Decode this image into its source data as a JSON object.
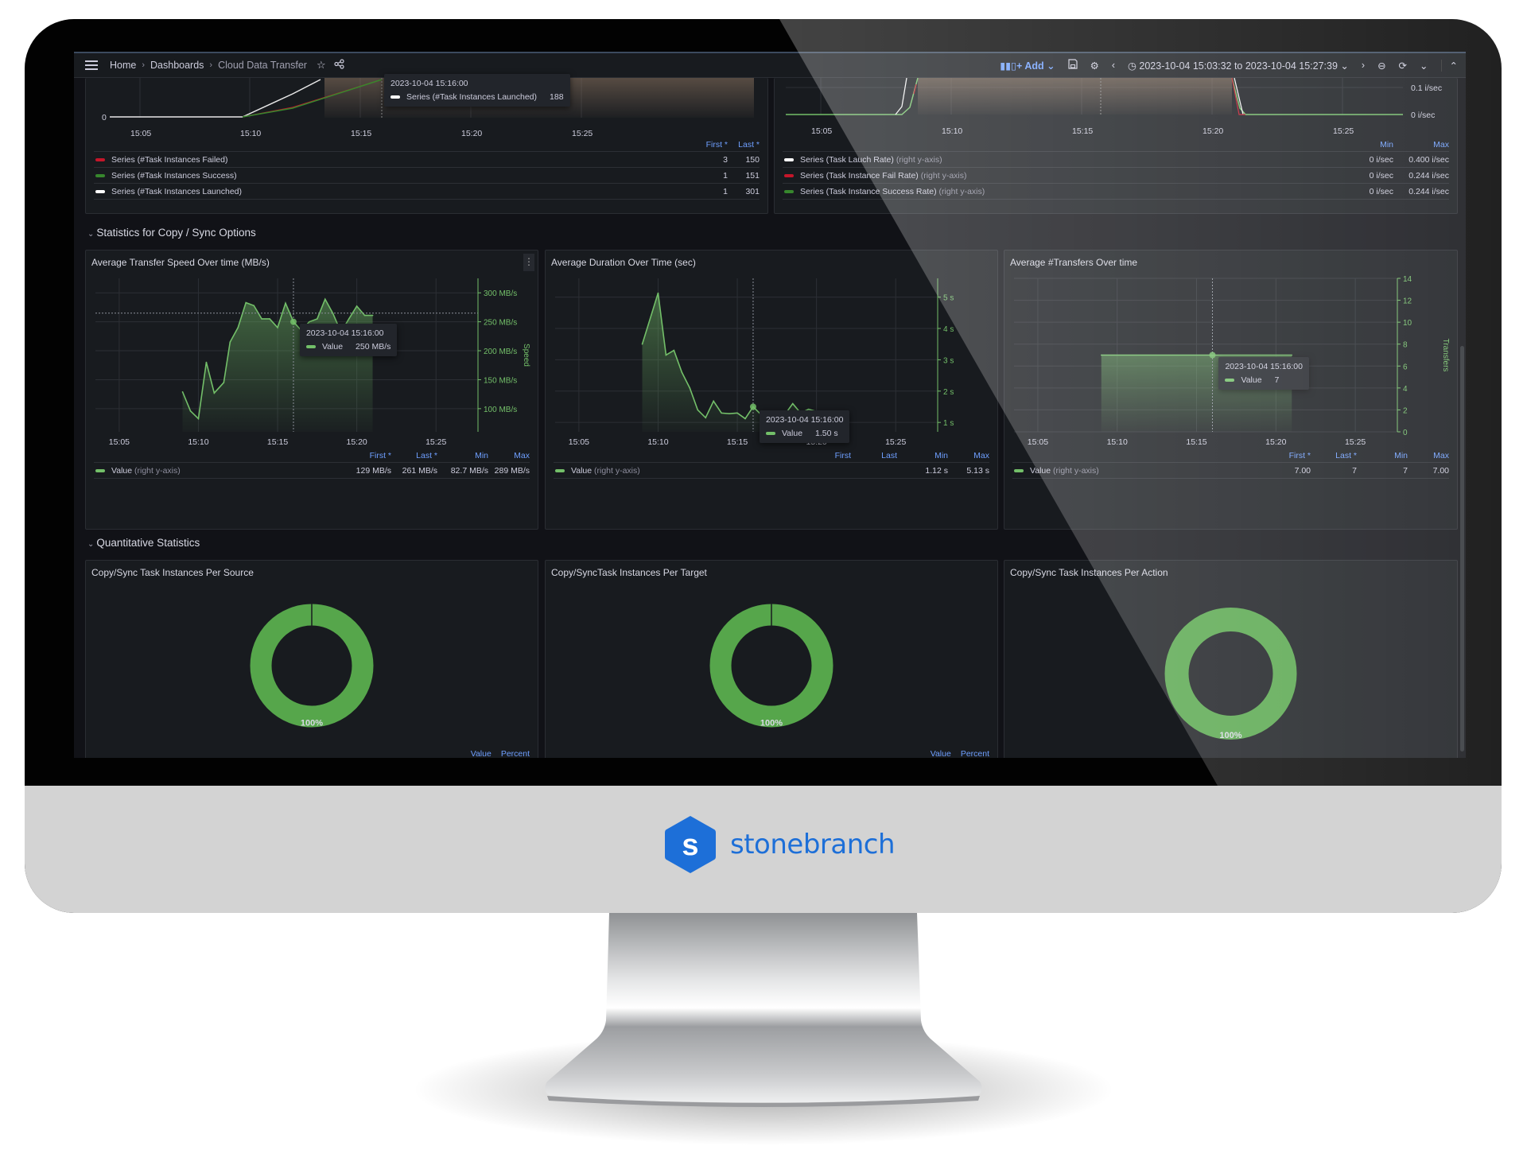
{
  "nav": {
    "breadcrumb": [
      "Home",
      "Dashboards",
      "Cloud Data Transfer"
    ],
    "add_label": "Add",
    "time_range": "2023-10-04 15:03:32 to 2023-10-04 15:27:39",
    "icons": [
      "menu-icon",
      "star-icon",
      "share-icon",
      "add-panel-icon",
      "save-icon",
      "settings-icon",
      "chevron-left-icon",
      "clock-icon",
      "chevron-down-icon",
      "chevron-right-icon",
      "zoom-out-icon",
      "refresh-icon",
      "chevron-down-icon",
      "chevron-up-icon"
    ]
  },
  "top_left_panel": {
    "tooltip": {
      "time": "2023-10-04 15:16:00",
      "series": "Series (#Task Instances Launched)",
      "value": "188"
    },
    "y_zero": "0",
    "x_ticks": [
      "15:05",
      "15:10",
      "15:15",
      "15:20",
      "15:25"
    ],
    "legend_headers": [
      "First *",
      "Last *"
    ],
    "legend": [
      {
        "name": "Series (#Task Instances Failed)",
        "first": "3",
        "last": "150",
        "color": "#c4162a"
      },
      {
        "name": "Series (#Task Instances Success)",
        "first": "1",
        "last": "151",
        "color": "#37872d"
      },
      {
        "name": "Series (#Task Instances Launched)",
        "first": "1",
        "last": "301",
        "color": "#ffffff"
      }
    ]
  },
  "top_right_panel": {
    "y_ticks": [
      "0.1 i/sec",
      "0 i/sec"
    ],
    "x_ticks": [
      "15:05",
      "15:10",
      "15:15",
      "15:20",
      "15:25"
    ],
    "legend_headers": [
      "Min",
      "Max"
    ],
    "legend": [
      {
        "name": "Series (Task Lauch Rate)",
        "axis": "(right y-axis)",
        "min": "0 i/sec",
        "max": "0.400 i/sec",
        "color": "#ffffff"
      },
      {
        "name": "Series (Task Instance Fail Rate)",
        "axis": "(right y-axis)",
        "min": "0 i/sec",
        "max": "0.244 i/sec",
        "color": "#c4162a"
      },
      {
        "name": "Series (Task Instance Success Rate)",
        "axis": "(right y-axis)",
        "min": "0 i/sec",
        "max": "0.244 i/sec",
        "color": "#37872d"
      }
    ]
  },
  "sections": {
    "copy_sync": "Statistics for Copy / Sync Options",
    "quantitative": "Quantitative Statistics"
  },
  "chart_data": [
    {
      "type": "area",
      "title": "Average Transfer Speed Over time (MB/s)",
      "ylabel": "Speed",
      "x_ticks": [
        "15:05",
        "15:10",
        "15:15",
        "15:20",
        "15:25"
      ],
      "y_ticks": [
        "100 MB/s",
        "150 MB/s",
        "200 MB/s",
        "250 MB/s",
        "300 MB/s"
      ],
      "xlim_minutes": [
        3.5,
        27.65
      ],
      "ylim": [
        60,
        325
      ],
      "x_minutes": [
        9.0,
        9.5,
        10.0,
        10.5,
        11.0,
        11.6,
        12.0,
        12.5,
        13.0,
        13.5,
        14.0,
        14.5,
        15.0,
        15.5,
        16.0,
        16.5,
        17.0,
        17.5,
        18.0,
        18.5,
        19.0,
        19.5,
        20.0,
        20.5,
        21.0
      ],
      "values": [
        129,
        96,
        82.7,
        180,
        127,
        145,
        215,
        240,
        283,
        278,
        255,
        255,
        240,
        282,
        250,
        235,
        250,
        255,
        289,
        264,
        232,
        255,
        277,
        261,
        261
      ],
      "tooltip": {
        "time": "2023-10-04 15:16:00",
        "label": "Value",
        "value": "250 MB/s"
      },
      "legend_headers": [
        "First *",
        "Last *",
        "Min",
        "Max"
      ],
      "legend": {
        "name": "Value",
        "axis": "(right y-axis)",
        "first": "129 MB/s",
        "last": "261 MB/s",
        "min": "82.7 MB/s",
        "max": "289 MB/s"
      }
    },
    {
      "type": "area",
      "title": "Average Duration Over Time (sec)",
      "ylabel": "",
      "x_ticks": [
        "15:05",
        "15:10",
        "15:15",
        "15:20",
        "15:25"
      ],
      "y_ticks": [
        "1 s",
        "2 s",
        "3 s",
        "4 s",
        "5 s"
      ],
      "xlim_minutes": [
        3.5,
        27.65
      ],
      "ylim": [
        0.7,
        5.6
      ],
      "x_minutes": [
        9.0,
        10.0,
        10.5,
        11.0,
        11.5,
        12.0,
        12.5,
        13.0,
        13.5,
        14.0,
        14.5,
        15.0,
        15.5,
        16.0,
        16.5,
        17.0,
        17.5,
        18.0,
        18.5,
        19.0,
        19.5,
        20.0
      ],
      "values": [
        3.5,
        5.13,
        3.15,
        3.3,
        2.6,
        2.1,
        1.4,
        1.15,
        1.68,
        1.3,
        1.28,
        1.3,
        1.12,
        1.5,
        1.25,
        1.3,
        1.35,
        1.25,
        1.6,
        1.3,
        1.42,
        1.35
      ],
      "tooltip": {
        "time": "2023-10-04 15:16:00",
        "label": "Value",
        "value": "1.50 s"
      },
      "legend_headers": [
        "First",
        "Last",
        "Min",
        "Max"
      ],
      "legend": {
        "name": "Value",
        "axis": "(right y-axis)",
        "first": "",
        "last": "",
        "min": "1.12 s",
        "max": "5.13 s"
      }
    },
    {
      "type": "area",
      "title": "Average #Transfers Over time",
      "ylabel": "Transfers",
      "x_ticks": [
        "15:05",
        "15:10",
        "15:15",
        "15:20",
        "15:25"
      ],
      "y_ticks": [
        "0",
        "2",
        "4",
        "6",
        "8",
        "10",
        "12",
        "14"
      ],
      "xlim_minutes": [
        3.5,
        27.65
      ],
      "ylim": [
        0,
        14
      ],
      "x_minutes": [
        9.0,
        21.0
      ],
      "values": [
        7,
        7
      ],
      "tooltip": {
        "time": "2023-10-04 15:16:00",
        "label": "Value",
        "value": "7"
      },
      "legend_headers": [
        "First *",
        "Last *",
        "Min",
        "Max"
      ],
      "legend": {
        "name": "Value",
        "axis": "(right y-axis)",
        "first": "7.00",
        "last": "7",
        "min": "7",
        "max": "7.00"
      }
    },
    {
      "type": "pie",
      "title": "Copy/Sync Task Instances Per Source",
      "slices": [
        {
          "label": "",
          "percent": 100
        }
      ],
      "slice_label": "100%",
      "legend_headers": [
        "Value",
        "Percent"
      ]
    },
    {
      "type": "pie",
      "title": "Copy/SyncTask Instances Per Target",
      "slices": [
        {
          "label": "",
          "percent": 100
        }
      ],
      "slice_label": "100%",
      "legend_headers": [
        "Value",
        "Percent"
      ]
    },
    {
      "type": "pie",
      "title": "Copy/Sync Task Instances Per Action",
      "slices": [
        {
          "label": "",
          "percent": 100
        }
      ],
      "slice_label": "100%",
      "legend_headers": []
    }
  ],
  "brand": {
    "name": "stonebranch",
    "mark": "s",
    "color": "#1d6fd8"
  },
  "colors": {
    "green": "#73bf69",
    "panel_bg": "#181b1f",
    "link_blue": "#6e9fff"
  }
}
